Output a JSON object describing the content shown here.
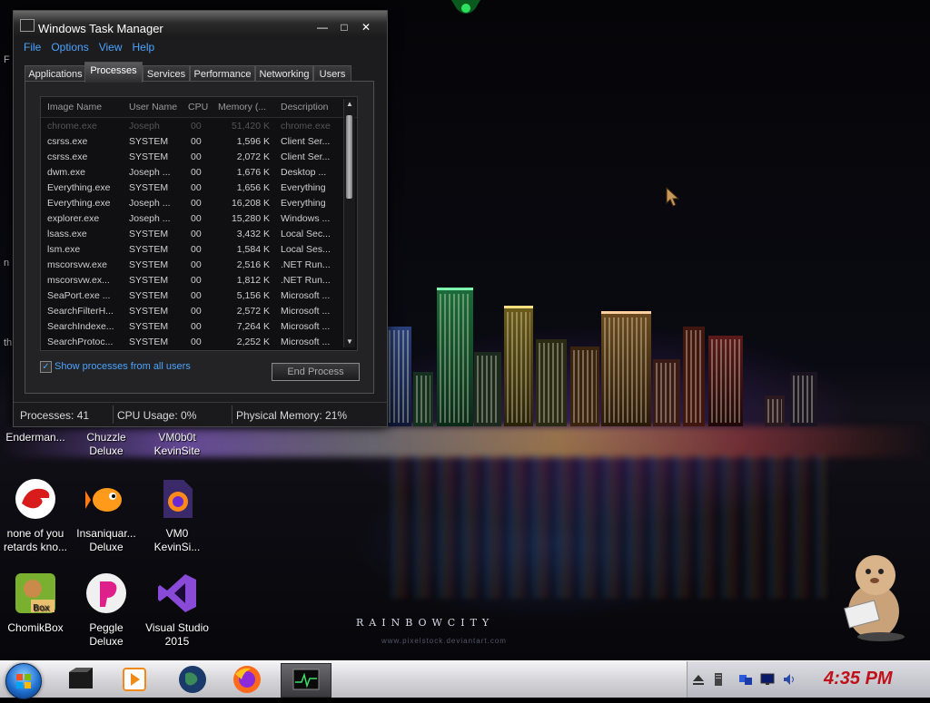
{
  "window": {
    "title": "Windows Task Manager",
    "minimize_glyph": "—",
    "maximize_glyph": "□",
    "close_glyph": "✕"
  },
  "menu": [
    "File",
    "Options",
    "View",
    "Help"
  ],
  "tabs": [
    {
      "label": "Applications",
      "active": false
    },
    {
      "label": "Processes",
      "active": true
    },
    {
      "label": "Services",
      "active": false
    },
    {
      "label": "Performance",
      "active": false
    },
    {
      "label": "Networking",
      "active": false
    },
    {
      "label": "Users",
      "active": false
    }
  ],
  "processes": {
    "columns": [
      "Image Name",
      "User Name",
      "CPU",
      "Memory (...",
      "Description"
    ],
    "rows": [
      {
        "name": "chrome.exe",
        "user": "Joseph",
        "cpu": "00",
        "memory": "51,420 K",
        "description": "chrome.exe"
      },
      {
        "name": "csrss.exe",
        "user": "SYSTEM",
        "cpu": "00",
        "memory": "1,596 K",
        "description": "Client Ser..."
      },
      {
        "name": "csrss.exe",
        "user": "SYSTEM",
        "cpu": "00",
        "memory": "2,072 K",
        "description": "Client Ser..."
      },
      {
        "name": "dwm.exe",
        "user": "Joseph ...",
        "cpu": "00",
        "memory": "1,676 K",
        "description": "Desktop ..."
      },
      {
        "name": "Everything.exe",
        "user": "SYSTEM",
        "cpu": "00",
        "memory": "1,656 K",
        "description": "Everything"
      },
      {
        "name": "Everything.exe",
        "user": "Joseph ...",
        "cpu": "00",
        "memory": "16,208 K",
        "description": "Everything"
      },
      {
        "name": "explorer.exe",
        "user": "Joseph ...",
        "cpu": "00",
        "memory": "15,280 K",
        "description": "Windows ..."
      },
      {
        "name": "lsass.exe",
        "user": "SYSTEM",
        "cpu": "00",
        "memory": "3,432 K",
        "description": "Local Sec..."
      },
      {
        "name": "lsm.exe",
        "user": "SYSTEM",
        "cpu": "00",
        "memory": "1,584 K",
        "description": "Local Ses..."
      },
      {
        "name": "mscorsvw.exe",
        "user": "SYSTEM",
        "cpu": "00",
        "memory": "2,516 K",
        "description": ".NET Run..."
      },
      {
        "name": "mscorsvw.ex...",
        "user": "SYSTEM",
        "cpu": "00",
        "memory": "1,812 K",
        "description": ".NET Run..."
      },
      {
        "name": "SeaPort.exe ...",
        "user": "SYSTEM",
        "cpu": "00",
        "memory": "5,156 K",
        "description": "Microsoft ..."
      },
      {
        "name": "SearchFilterH...",
        "user": "SYSTEM",
        "cpu": "00",
        "memory": "2,572 K",
        "description": "Microsoft ..."
      },
      {
        "name": "SearchIndexe...",
        "user": "SYSTEM",
        "cpu": "00",
        "memory": "7,264 K",
        "description": "Microsoft ..."
      },
      {
        "name": "SearchProtoc...",
        "user": "SYSTEM",
        "cpu": "00",
        "memory": "2,252 K",
        "description": "Microsoft ..."
      }
    ],
    "show_all_label": "Show processes from all users",
    "show_all_checked": true,
    "end_process_label": "End Process"
  },
  "status": {
    "processes": "Processes: 41",
    "cpu": "CPU Usage: 0%",
    "memory": "Physical Memory: 21%"
  },
  "desktop_icons": [
    {
      "label": "Enderman...",
      "icon": "none"
    },
    {
      "label": "Chuzzle Deluxe",
      "icon": "none"
    },
    {
      "label": "VM0b0t KevinSite",
      "icon": "none"
    },
    {
      "label": "none of you retards kno...",
      "icon": "red-dino-icon"
    },
    {
      "label": "Insaniquar... Deluxe",
      "icon": "goldfish-icon"
    },
    {
      "label": "VM0 KevinSi...",
      "icon": "firefox-file-icon"
    },
    {
      "label": "ChomikBox",
      "icon": "hamster-box-icon"
    },
    {
      "label": "Peggle Deluxe",
      "icon": "peggle-icon"
    },
    {
      "label": "Visual Studio 2015",
      "icon": "visual-studio-icon"
    }
  ],
  "wallpaper": {
    "caption": "RAINBOWCITY",
    "url": "www.pixelstock.deviantart.com"
  },
  "edge_text": [
    "F",
    "n",
    "th"
  ],
  "taskbar": {
    "clock": "4:35 PM",
    "pinned": [
      "console-icon",
      "media-player-icon",
      "globe-icon",
      "firefox-icon",
      "task-manager-icon"
    ]
  },
  "colors": {
    "link_blue": "#4aa3ff",
    "clock_red": "#c0101a"
  }
}
